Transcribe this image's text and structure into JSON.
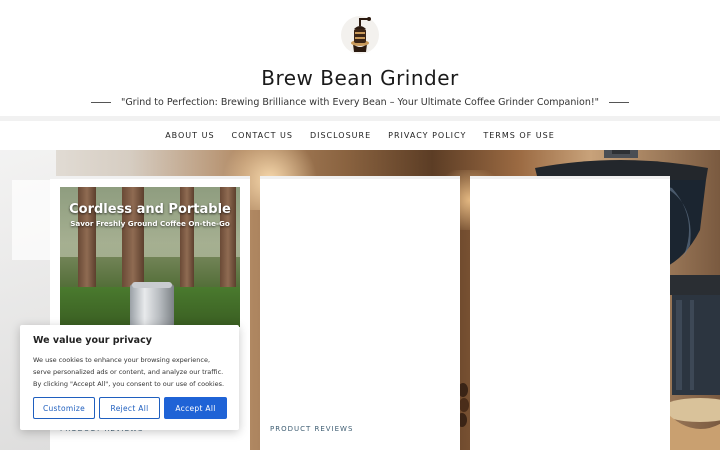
{
  "site": {
    "title": "Brew Bean Grinder",
    "tagline": "\"Grind to Perfection: Brewing Brilliance with Every Bean – Your Ultimate Coffee Grinder Companion!\"",
    "logo_icon": "coffee-grinder-logo-icon"
  },
  "nav": {
    "items": [
      {
        "label": "ABOUT US"
      },
      {
        "label": "CONTACT US"
      },
      {
        "label": "DISCLOSURE"
      },
      {
        "label": "PRIVACY POLICY"
      },
      {
        "label": "TERMS OF USE"
      }
    ]
  },
  "posts": [
    {
      "thumbnail_title": "Cordless and Portable",
      "thumbnail_subtitle": "Savor Freshly Ground Coffee On-the-Go",
      "category": "PRODUCT REVIEWS"
    },
    {
      "category": "PRODUCT REVIEWS"
    },
    {}
  ],
  "cookie_banner": {
    "title": "We value your privacy",
    "text": "We use cookies to enhance your browsing experience, serve personalized ads or content, and analyze our traffic. By clicking \"Accept All\", you consent to our use of cookies.",
    "buttons": {
      "customize": "Customize",
      "reject": "Reject All",
      "accept": "Accept All"
    }
  },
  "colors": {
    "accent": "#1f63d6",
    "category_text": "#3f5e73"
  }
}
